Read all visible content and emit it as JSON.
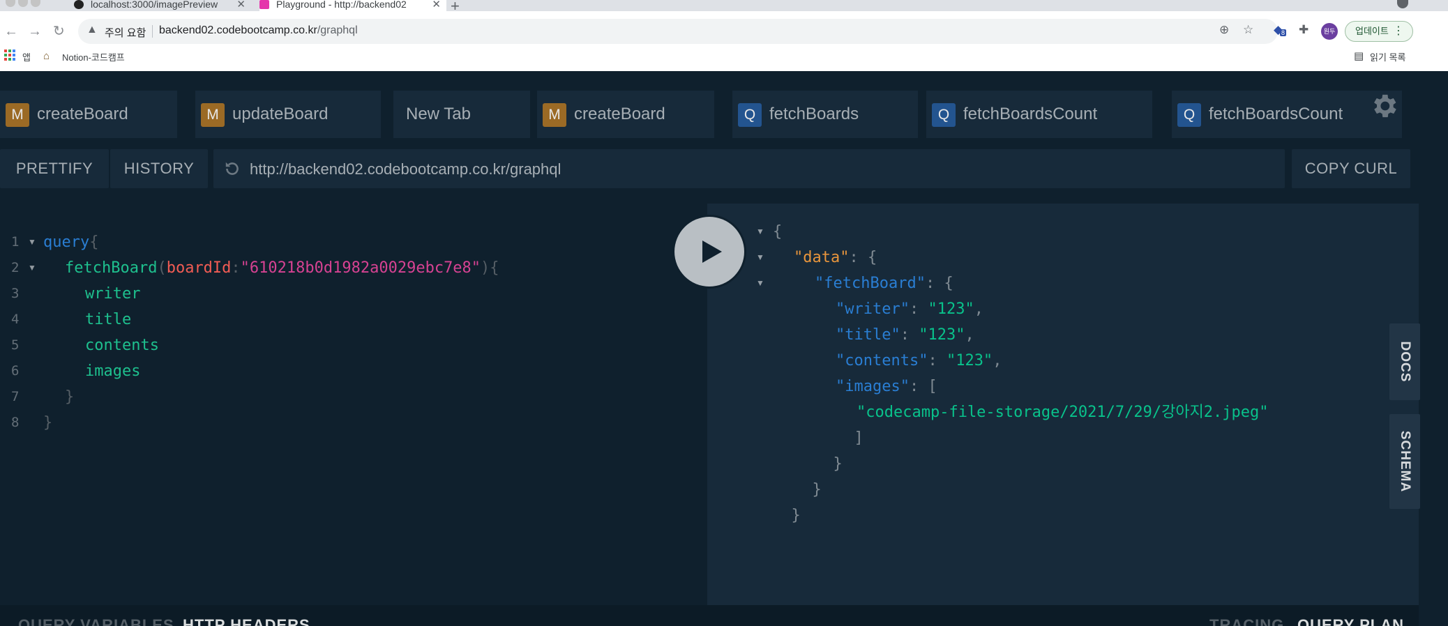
{
  "browser": {
    "tabs": [
      {
        "title": "localhost:3000/imagePreview"
      },
      {
        "title": "Playground - http://backend02"
      }
    ],
    "new_tab_label": "+",
    "address": {
      "security_warning": "주의 요함",
      "url_host": "backend02.codebootcamp.co.kr",
      "url_path": "/graphql"
    },
    "extensions_badge": "8",
    "profile_label": "원두",
    "update_button": "업데이트",
    "bookmarks": {
      "apps": "앱",
      "items": [
        "Notion-코드캠프"
      ],
      "reading_list": "읽기 목록"
    }
  },
  "playground": {
    "tabs": [
      {
        "type": "M",
        "label": "createBoard"
      },
      {
        "type": "M",
        "label": "updateBoard"
      },
      {
        "type": "",
        "label": "New Tab"
      },
      {
        "type": "M",
        "label": "createBoard"
      },
      {
        "type": "Q",
        "label": "fetchBoards"
      },
      {
        "type": "Q",
        "label": "fetchBoardsCount"
      },
      {
        "type": "Q",
        "label": "fetchBoardsCount"
      }
    ],
    "toolbar": {
      "prettify": "PRETTIFY",
      "history": "HISTORY",
      "endpoint": "http://backend02.codebootcamp.co.kr/graphql",
      "copy_curl": "COPY CURL"
    },
    "editor": {
      "line_numbers": [
        "1",
        "2",
        "3",
        "4",
        "5",
        "6",
        "7",
        "8"
      ],
      "query_keyword": "query",
      "operation": "fetchBoard",
      "arg_name": "boardId",
      "arg_value": "\"610218b0d1982a0029ebc7e8\"",
      "fields": [
        "writer",
        "title",
        "contents",
        "images"
      ]
    },
    "result": {
      "data_key": "\"data\"",
      "op_key": "\"fetchBoard\"",
      "rows": [
        {
          "key": "\"writer\"",
          "value": "\"123\""
        },
        {
          "key": "\"title\"",
          "value": "\"123\""
        },
        {
          "key": "\"contents\"",
          "value": "\"123\""
        }
      ],
      "images_key": "\"images\"",
      "images_values": [
        "\"codecamp-file-storage/2021/7/29/강아지2.jpeg\""
      ]
    },
    "side_tabs": {
      "docs": "DOCS",
      "schema": "SCHEMA"
    },
    "bottom": {
      "query_variables": "QUERY VARIABLES",
      "http_headers": "HTTP HEADERS",
      "tracing": "TRACING",
      "query_plan": "QUERY PLAN"
    }
  }
}
